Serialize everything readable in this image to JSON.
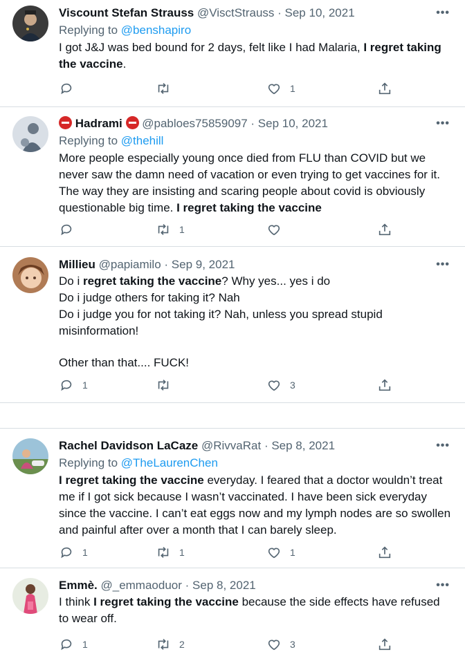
{
  "tweets": [
    {
      "name": "Viscount Stefan Strauss",
      "handle": "@VisctStrauss",
      "date": "Sep 10, 2021",
      "replying_prefix": "Replying to ",
      "replying_to": "@benshapiro",
      "text_pre": "I got J&J was bed bound for 2 days, felt like I had Malaria, ",
      "text_bold": "I regret taking the vaccine",
      "text_post": ".",
      "replies": "",
      "retweets": "",
      "likes": "1"
    },
    {
      "name": "Hadrami",
      "handle": "@pabloes75859097",
      "date": "Sep 10, 2021",
      "replying_prefix": "Replying to ",
      "replying_to": "@thehill",
      "text_pre": "More people especially young once died from FLU than COVID but we never saw the damn need of vacation or even trying to get vaccines for it. The way they are insisting and scaring people about covid is obviously questionable big time. ",
      "text_bold": "I regret taking the vaccine",
      "text_post": "",
      "replies": "",
      "retweets": "1",
      "likes": ""
    },
    {
      "name": "Millieu",
      "handle": "@papiamilo",
      "date": "Sep 9, 2021",
      "text_pre": "Do i ",
      "text_bold": "regret taking the vaccine",
      "text_post": "? Why yes... yes i do",
      "line2": "Do i judge others for taking it? Nah",
      "line3": "Do i judge you for not taking it? Nah, unless you spread stupid misinformation!",
      "line4": "Other than that.... FUCK!",
      "replies": "1",
      "retweets": "",
      "likes": "3"
    },
    {
      "name": "Rachel Davidson LaCaze",
      "handle": "@RivvaRat",
      "date": "Sep 8, 2021",
      "replying_prefix": "Replying to ",
      "replying_to": "@TheLaurenChen",
      "text_pre": "",
      "text_bold": "I regret taking the vaccine",
      "text_post": " everyday. I feared that a doctor wouldn’t treat me if I got sick because I wasn’t vaccinated. I have been sick everyday since the vaccine. I can’t eat eggs now and my lymph nodes are so swollen and painful after over a month that I can barely sleep.",
      "replies": "1",
      "retweets": "1",
      "likes": "1"
    },
    {
      "name": "Emmè.",
      "handle": "@_emmaoduor",
      "date": "Sep 8, 2021",
      "text_pre": "I think ",
      "text_bold": "I regret taking the vaccine",
      "text_post": " because the side effects have refused to wear off.",
      "replies": "1",
      "retweets": "2",
      "likes": "3"
    }
  ],
  "separator": " · ",
  "icons": [
    "reply-icon",
    "retweet-icon",
    "like-icon",
    "share-icon",
    "more-icon",
    "no-entry-icon"
  ],
  "colors": {
    "link": "#1d9bf0",
    "muted": "#536471",
    "text": "#0f1419",
    "divider": "#d7dde2",
    "no_entry": "#d62828"
  }
}
